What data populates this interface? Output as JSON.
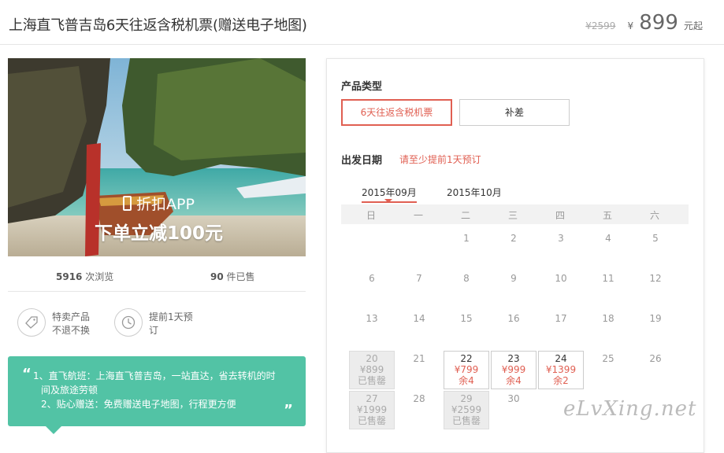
{
  "header": {
    "title": "上海直飞普吉岛6天往返含税机票(赠送电子地图)",
    "original_price": "¥2599",
    "currency": "¥",
    "price": "899",
    "price_suffix": "元起"
  },
  "promo": {
    "line1": "折扣APP",
    "line2": "下单立减100元"
  },
  "stats": {
    "views_count": "5916",
    "views_label": "次浏览",
    "sold_count": "90",
    "sold_label": "件已售"
  },
  "badges": [
    {
      "icon": "tag-icon",
      "line1": "特卖产品",
      "line2": "不退不换"
    },
    {
      "icon": "clock-icon",
      "line1": "提前1天预",
      "line2": "订"
    }
  ],
  "notes": {
    "open_quote": "“",
    "close_quote": "”",
    "line1": "1、直飞航班：上海直飞普吉岛，一站直达，省去转机的时",
    "line2": "间及旅途劳顿",
    "line3": "2、贴心赠送：免费赠送电子地图，行程更方便"
  },
  "booking": {
    "product_type_label": "产品类型",
    "options": [
      "6天往返含税机票",
      "补差"
    ],
    "date_label": "出发日期",
    "date_hint": "请至少提前1天预订",
    "months": [
      "2015年09月",
      "2015年10月"
    ],
    "weekdays": [
      "日",
      "一",
      "二",
      "三",
      "四",
      "五",
      "六"
    ],
    "days": {
      "1": "1",
      "2": "2",
      "3": "3",
      "4": "4",
      "5": "5",
      "6": "6",
      "7": "7",
      "8": "8",
      "9": "9",
      "10": "10",
      "11": "11",
      "12": "12",
      "13": "13",
      "14": "14",
      "15": "15",
      "16": "16",
      "17": "17",
      "18": "18",
      "19": "19",
      "21": "21",
      "25": "25",
      "26": "26",
      "28": "28",
      "30": "30"
    },
    "special_days": {
      "d20": {
        "day": "20",
        "price": "¥899",
        "status": "已售罄"
      },
      "d22": {
        "day": "22",
        "price": "¥799",
        "status": "余4"
      },
      "d23": {
        "day": "23",
        "price": "¥999",
        "status": "余4"
      },
      "d24": {
        "day": "24",
        "price": "¥1399",
        "status": "余2"
      },
      "d27": {
        "day": "27",
        "price": "¥1999",
        "status": "已售罄"
      },
      "d29": {
        "day": "29",
        "price": "¥2599",
        "status": "已售罄"
      }
    }
  },
  "watermark": "eLvXing.net",
  "colors": {
    "accent": "#e05f52",
    "notes_bg": "#52c3a5"
  }
}
